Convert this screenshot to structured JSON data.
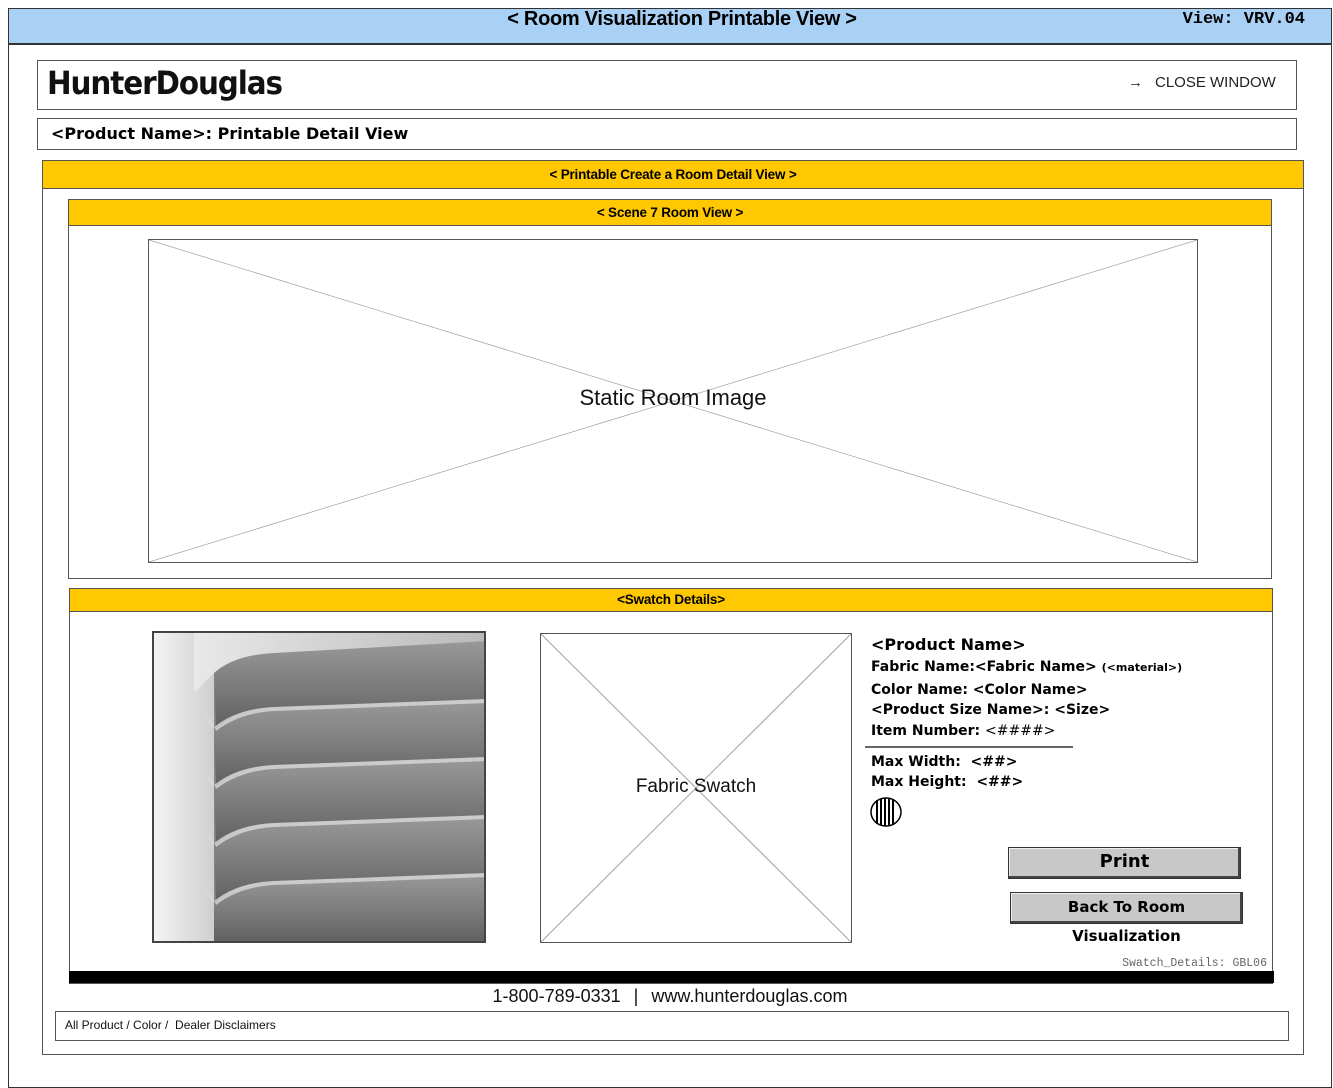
{
  "window": {
    "title": "< Room Visualization Printable View >",
    "view_id": "View: VRV.04"
  },
  "header": {
    "logo": "HunterDouglas",
    "close_label": "CLOSE WINDOW",
    "close_icon": "arrow-right-icon"
  },
  "product_title": "<Product Name>: Printable Detail View",
  "create_room_bar": "< Printable Create a Room Detail View >",
  "scene": {
    "bar_label": "< Scene 7 Room View >",
    "room_image_label": "Static Room Image"
  },
  "swatch": {
    "bar_label": "<Swatch Details>",
    "fabric_label": "Fabric Swatch",
    "product_name": "<Product Name>",
    "fabric_name": "Fabric Name:<Fabric Name>",
    "material": "(<material>)",
    "color_name": "Color Name: <Color Name>",
    "size": "<Product Size Name>: <Size>",
    "item_label": "Item Number:",
    "item_value": "<####>",
    "max_width": "Max Width:  <##>",
    "max_height": "Max Height:  <##>",
    "print_label": "Print",
    "back_label": "Back To Room Visualization",
    "screen_id": "Swatch_Details: GBL06"
  },
  "footer": {
    "phone": "1-800-789-0331",
    "separator": "|",
    "website": "www.hunterdouglas.com",
    "disclaimer": "All Product / Color /  Dealer Disclaimers"
  },
  "colors": {
    "topbar": "#a9d0f5",
    "section_bar": "#ffc800",
    "button": "#c8c8c8"
  }
}
